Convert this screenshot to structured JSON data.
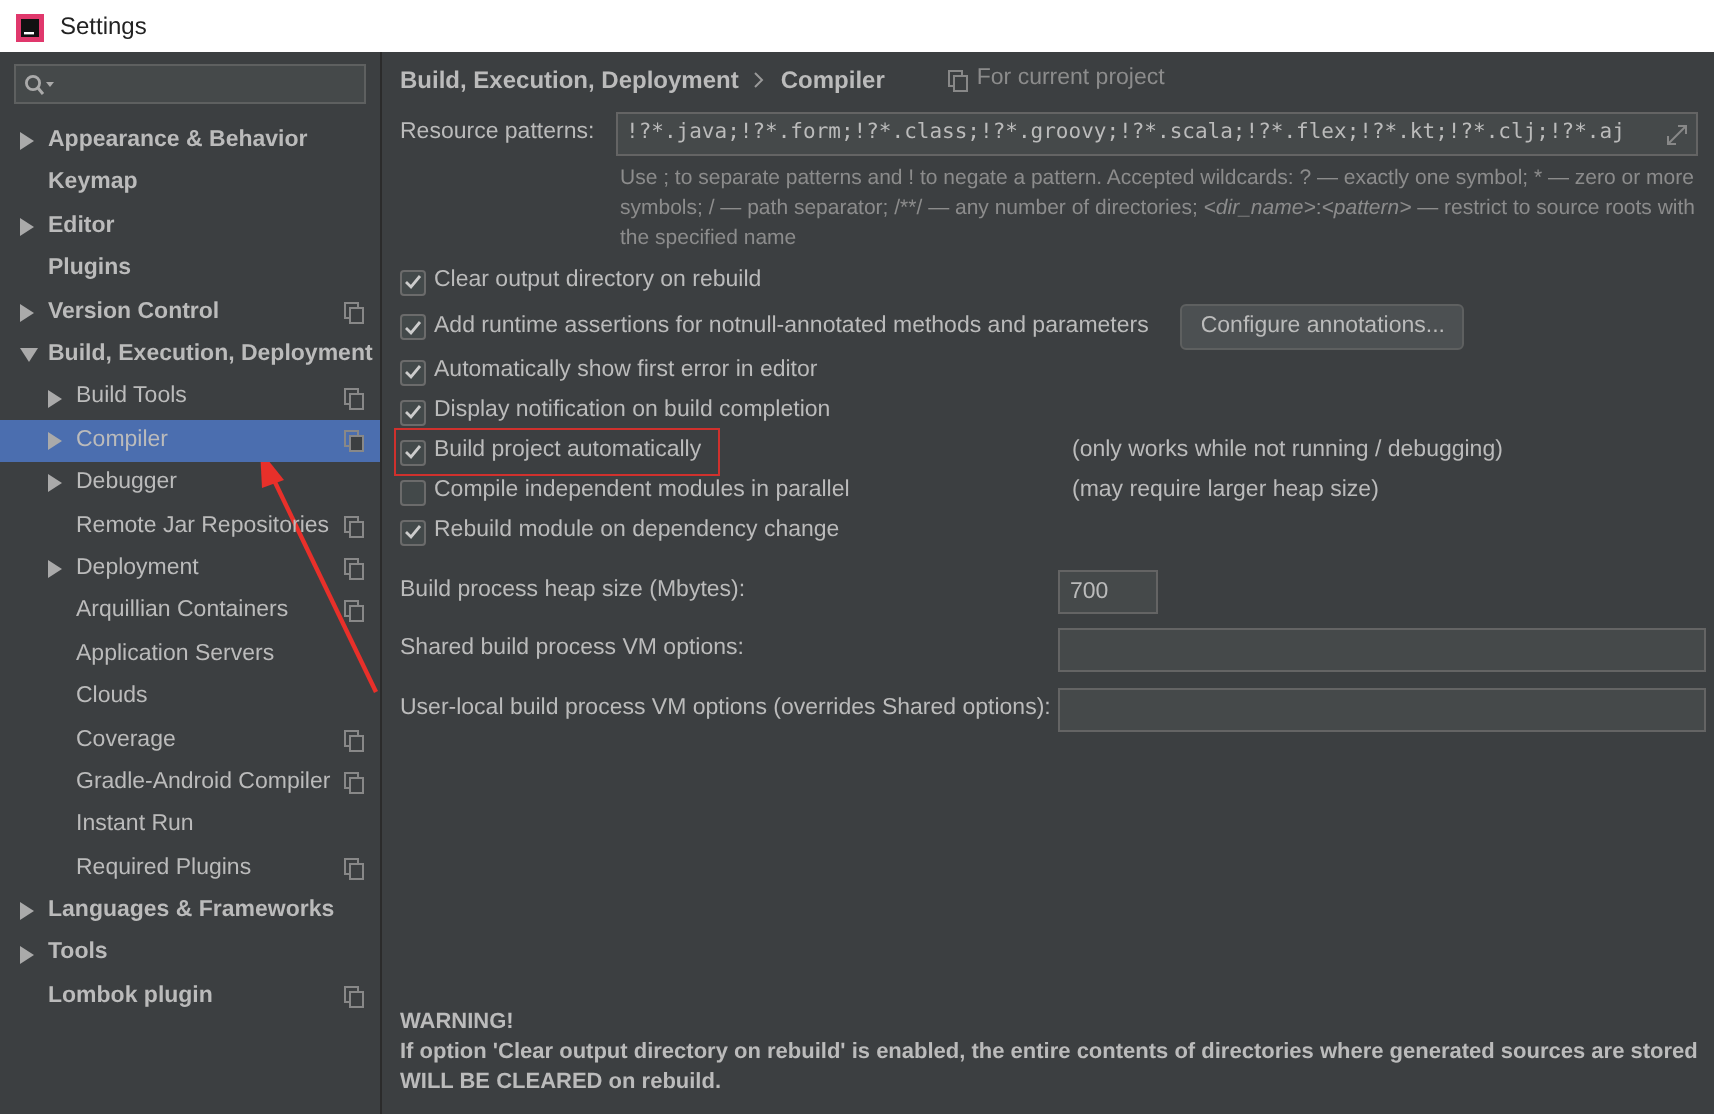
{
  "window": {
    "title": "Settings"
  },
  "sidebar": {
    "items": [
      {
        "label": "Appearance & Behavior",
        "expanded": false,
        "selected": false
      },
      {
        "label": "Keymap",
        "selected": false
      },
      {
        "label": "Editor",
        "expanded": false,
        "selected": false
      },
      {
        "label": "Plugins",
        "selected": false
      },
      {
        "label": "Version Control",
        "expanded": false,
        "selected": false,
        "project_scope": true
      },
      {
        "label": "Build, Execution, Deployment",
        "expanded": true,
        "selected": false,
        "children": [
          {
            "label": "Build Tools",
            "expanded": false,
            "selected": false,
            "project_scope": true
          },
          {
            "label": "Compiler",
            "expanded": false,
            "selected": true,
            "project_scope": true
          },
          {
            "label": "Debugger",
            "expanded": false,
            "selected": false
          },
          {
            "label": "Remote Jar Repositories",
            "selected": false,
            "project_scope": true
          },
          {
            "label": "Deployment",
            "expanded": false,
            "selected": false,
            "project_scope": true
          },
          {
            "label": "Arquillian Containers",
            "selected": false,
            "project_scope": true
          },
          {
            "label": "Application Servers",
            "selected": false
          },
          {
            "label": "Clouds",
            "selected": false
          },
          {
            "label": "Coverage",
            "selected": false,
            "project_scope": true
          },
          {
            "label": "Gradle-Android Compiler",
            "selected": false,
            "project_scope": true
          },
          {
            "label": "Instant Run",
            "selected": false
          },
          {
            "label": "Required Plugins",
            "selected": false,
            "project_scope": true
          }
        ]
      },
      {
        "label": "Languages & Frameworks",
        "expanded": false,
        "selected": false
      },
      {
        "label": "Tools",
        "expanded": false,
        "selected": false
      },
      {
        "label": "Lombok plugin",
        "selected": false,
        "project_scope": true
      }
    ]
  },
  "breadcrumb": [
    "Build, Execution, Deployment",
    "Compiler"
  ],
  "scope_label": "For current project",
  "resource_patterns": {
    "label": "Resource patterns:",
    "value": "!?*.java;!?*.form;!?*.class;!?*.groovy;!?*.scala;!?*.flex;!?*.kt;!?*.clj;!?*.aj",
    "hint": "Use ; to separate patterns and ! to negate a pattern. Accepted wildcards: ? — exactly one symbol; * — zero or more symbols; / — path separator; /**/ — any number of directories; *<dir_name>*:*<pattern>* — restrict to source roots with the specified name"
  },
  "options": [
    {
      "label": "Clear output directory on rebuild",
      "checked": true
    },
    {
      "label": "Add runtime assertions for notnull-annotated methods and parameters",
      "checked": true,
      "button": "Configure annotations..."
    },
    {
      "label": "Automatically show first error in editor",
      "checked": true
    },
    {
      "label": "Display notification on build completion",
      "checked": true
    },
    {
      "label": "Build project automatically",
      "checked": true,
      "highlighted": true,
      "note": "(only works while not running / debugging)"
    },
    {
      "label": "Compile independent modules in parallel",
      "checked": false,
      "note": "(may require larger heap size)"
    },
    {
      "label": "Rebuild module on dependency change",
      "checked": true
    }
  ],
  "fields": [
    {
      "label": "Build process heap size (Mbytes):",
      "value": "700",
      "kind": "short"
    },
    {
      "label": "Shared build process VM options:",
      "kind": "wide"
    },
    {
      "label": "User-local build process VM options (overrides Shared options):",
      "kind": "wide"
    }
  ],
  "warning": {
    "title": "WARNING!",
    "text": "If option 'Clear output directory on rebuild' is enabled, the entire contents of directories where generated sources are stored WILL BE CLEARED on rebuild."
  }
}
